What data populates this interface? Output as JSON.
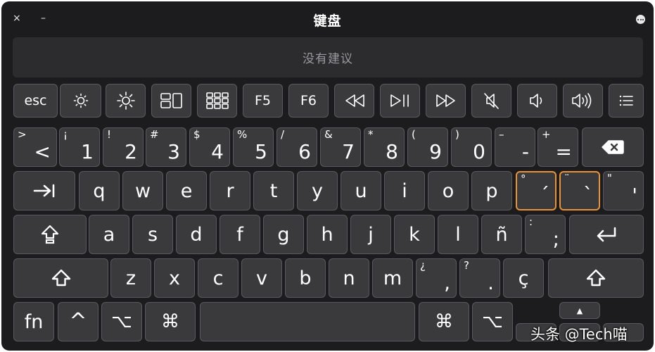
{
  "window": {
    "title": "键盘",
    "close_glyph": "×",
    "minimize_glyph": "–",
    "more_icon": "ellipsis-circle-icon"
  },
  "suggestion_bar": {
    "text": "没有建议"
  },
  "function_row": [
    {
      "name": "esc-key",
      "label": "esc"
    },
    {
      "name": "brightness-down-key",
      "icon": "brightness-down-icon"
    },
    {
      "name": "brightness-up-key",
      "icon": "brightness-up-icon"
    },
    {
      "name": "mission-control-key",
      "icon": "mission-control-icon"
    },
    {
      "name": "launchpad-key",
      "icon": "launchpad-icon"
    },
    {
      "name": "f5-key",
      "label": "F5"
    },
    {
      "name": "f6-key",
      "label": "F6"
    },
    {
      "name": "rewind-key",
      "icon": "rewind-icon"
    },
    {
      "name": "play-pause-key",
      "icon": "play-pause-icon"
    },
    {
      "name": "fast-forward-key",
      "icon": "fast-forward-icon"
    },
    {
      "name": "mute-key",
      "icon": "mute-icon"
    },
    {
      "name": "volume-down-key",
      "icon": "volume-down-icon"
    },
    {
      "name": "volume-up-key",
      "icon": "volume-up-icon"
    },
    {
      "name": "menu-key",
      "icon": "list-icon"
    }
  ],
  "number_row": [
    {
      "name": "less-than-key",
      "shift": ">",
      "main": "<"
    },
    {
      "name": "key-1",
      "shift": "¡",
      "main": "1"
    },
    {
      "name": "key-2",
      "shift": "!",
      "main": "2"
    },
    {
      "name": "key-3",
      "shift": "#",
      "main": "3"
    },
    {
      "name": "key-4",
      "shift": "$",
      "main": "4"
    },
    {
      "name": "key-5",
      "shift": "%",
      "main": "5"
    },
    {
      "name": "key-6",
      "shift": "/",
      "main": "6"
    },
    {
      "name": "key-7",
      "shift": "&",
      "main": "7"
    },
    {
      "name": "key-8",
      "shift": "*",
      "main": "8"
    },
    {
      "name": "key-9",
      "shift": "(",
      "main": "9"
    },
    {
      "name": "key-0",
      "shift": ")",
      "main": "0"
    },
    {
      "name": "minus-key",
      "shift": "–",
      "main": "-"
    },
    {
      "name": "equals-key",
      "shift": "+",
      "main": "="
    },
    {
      "name": "delete-key",
      "icon": "delete-backward-icon"
    }
  ],
  "qwerty_row": [
    {
      "name": "tab-key",
      "icon": "tab-icon"
    },
    {
      "name": "key-q",
      "label": "q"
    },
    {
      "name": "key-w",
      "label": "w"
    },
    {
      "name": "key-e",
      "label": "e"
    },
    {
      "name": "key-r",
      "label": "r"
    },
    {
      "name": "key-t",
      "label": "t"
    },
    {
      "name": "key-y",
      "label": "y"
    },
    {
      "name": "key-u",
      "label": "u"
    },
    {
      "name": "key-i",
      "label": "i"
    },
    {
      "name": "key-o",
      "label": "o"
    },
    {
      "name": "key-p",
      "label": "p"
    },
    {
      "name": "ring-accent-key",
      "shift": "°",
      "main": "´",
      "highlighted": true
    },
    {
      "name": "grave-accent-key",
      "shift": "¨",
      "main": "`",
      "highlighted": true
    },
    {
      "name": "quote-key",
      "shift": "\"",
      "main": "'"
    }
  ],
  "home_row": [
    {
      "name": "caps-lock-key",
      "icon": "caps-lock-icon"
    },
    {
      "name": "key-a",
      "label": "a"
    },
    {
      "name": "key-s",
      "label": "s"
    },
    {
      "name": "key-d",
      "label": "d"
    },
    {
      "name": "key-f",
      "label": "f"
    },
    {
      "name": "key-g",
      "label": "g"
    },
    {
      "name": "key-h",
      "label": "h"
    },
    {
      "name": "key-j",
      "label": "j"
    },
    {
      "name": "key-k",
      "label": "k"
    },
    {
      "name": "key-l",
      "label": "l"
    },
    {
      "name": "key-n-tilde",
      "label": "ñ"
    },
    {
      "name": "semicolon-key",
      "shift": ":",
      "main": ";"
    },
    {
      "name": "return-key",
      "icon": "return-icon"
    }
  ],
  "bottom_row": [
    {
      "name": "left-shift-key",
      "icon": "shift-icon"
    },
    {
      "name": "key-z",
      "label": "z"
    },
    {
      "name": "key-x",
      "label": "x"
    },
    {
      "name": "key-c",
      "label": "c"
    },
    {
      "name": "key-v",
      "label": "v"
    },
    {
      "name": "key-b",
      "label": "b"
    },
    {
      "name": "key-n",
      "label": "n"
    },
    {
      "name": "key-m",
      "label": "m"
    },
    {
      "name": "comma-key",
      "shift": "¿",
      "main": ","
    },
    {
      "name": "period-key",
      "shift": "?",
      "main": "."
    },
    {
      "name": "key-c-cedilla",
      "label": "ç"
    },
    {
      "name": "right-shift-key",
      "icon": "shift-icon"
    }
  ],
  "space_row": [
    {
      "name": "fn-key",
      "label": "fn"
    },
    {
      "name": "control-key",
      "glyph": "^"
    },
    {
      "name": "left-option-key",
      "glyph": "⌥"
    },
    {
      "name": "left-command-key",
      "glyph": "⌘"
    },
    {
      "name": "space-bar"
    },
    {
      "name": "right-command-key",
      "glyph": "⌘"
    },
    {
      "name": "right-option-key",
      "glyph": "⌥"
    },
    {
      "name": "arrow-up-key",
      "glyph": "▲"
    },
    {
      "name": "arrow-left-key"
    },
    {
      "name": "arrow-down-key"
    },
    {
      "name": "arrow-right-key"
    }
  ],
  "watermark": {
    "text": "头条 @Tech喵"
  },
  "colors": {
    "background": "#1c1c1e",
    "key": "#3a3a3c",
    "key_border": "#5a5a5e",
    "highlight": "#e8923a",
    "text": "#ffffff"
  }
}
